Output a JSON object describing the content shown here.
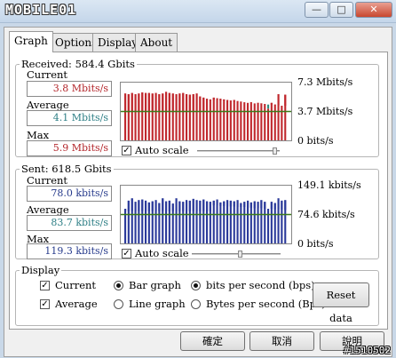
{
  "window": {
    "logo_text": "MOBILE01",
    "min_label": "—",
    "max_label": "□",
    "close_label": "✕"
  },
  "tabs": [
    {
      "label": "Graph"
    },
    {
      "label": "Options"
    },
    {
      "label": "Display"
    },
    {
      "label": "About"
    }
  ],
  "received": {
    "legend": "Received: 584.4 Gbits",
    "current_label": "Current",
    "current_value": "3.8 Mbits/s",
    "average_label": "Average",
    "average_value": "4.1 Mbits/s",
    "max_label": "Max",
    "max_value": "5.9 Mbits/s",
    "axis_top": "7.3 Mbits/s",
    "axis_mid": "3.7 Mbits/s",
    "axis_bottom": "0  bits/s",
    "autoscale_label": "Auto scale",
    "autoscale_checked": true,
    "slider_level": 0.97,
    "bar_color": "#c0282d",
    "avg_color": "#2f8c7e",
    "grid_color": "#3c7a1a",
    "avg_level": 0.5
  },
  "sent": {
    "legend": "Sent: 618.5 Gbits",
    "current_label": "Current",
    "current_value": "78.0 kbits/s",
    "average_label": "Average",
    "average_value": "83.7 kbits/s",
    "max_label": "Max",
    "max_value": "119.3 kbits/s",
    "axis_top": "149.1 kbits/s",
    "axis_mid": "74.6 kbits/s",
    "axis_bottom": "0  bits/s",
    "autoscale_label": "Auto scale",
    "autoscale_checked": true,
    "slider_level": 0.55,
    "bar_color": "#2b3a9a",
    "avg_color": "#2f8c7e",
    "grid_color": "#3c7a1a",
    "avg_level": 0.5
  },
  "display": {
    "legend": "Display",
    "current_label": "Current",
    "current_checked": true,
    "average_label": "Average",
    "average_checked": true,
    "bar_graph_label": "Bar graph",
    "bar_graph_selected": true,
    "line_graph_label": "Line graph",
    "line_graph_selected": false,
    "bps_label": "bits per second (bps)",
    "bps_selected": true,
    "Bps_label": "Bytes per second (Bps)",
    "Bps_selected": false,
    "reset_label": "Reset data"
  },
  "buttons": {
    "ok": "確定",
    "cancel": "取消",
    "help": "說明"
  },
  "watermark": "#1510502",
  "chart_data": [
    {
      "type": "bar",
      "series": [
        {
          "name": "Current",
          "color": "#c0282d",
          "values": [
            0.81,
            0.8,
            0.82,
            0.8,
            0.81,
            0.83,
            0.82,
            0.82,
            0.81,
            0.82,
            0.8,
            0.81,
            0.84,
            0.82,
            0.81,
            0.8,
            0.81,
            0.82,
            0.8,
            0.79,
            0.8,
            0.81,
            0.76,
            0.74,
            0.72,
            0.71,
            0.74,
            0.73,
            0.72,
            0.71,
            0.7,
            0.69,
            0.7,
            0.68,
            0.67,
            0.66,
            0.65,
            0.66,
            0.64,
            0.65,
            0.64,
            0.63,
            0.55,
            0.65,
            0.62,
            0.8,
            0.6,
            0.79
          ]
        },
        {
          "name": "Average",
          "color": "#2f8c7e",
          "values": [
            0.48,
            0.48,
            0.49,
            0.49,
            0.49,
            0.5,
            0.5,
            0.5,
            0.5,
            0.5,
            0.5,
            0.5,
            0.5,
            0.5,
            0.5,
            0.5,
            0.5,
            0.5,
            0.5,
            0.5,
            0.5,
            0.5,
            0.5,
            0.5,
            0.71,
            0.7,
            0.7,
            0.7,
            0.69,
            0.69,
            0.68,
            0.68,
            0.67,
            0.67,
            0.66,
            0.66,
            0.65,
            0.65,
            0.64,
            0.64,
            0.63,
            0.63,
            0.62,
            0.62,
            0.61,
            0.61,
            0.6,
            0.6
          ]
        }
      ]
    },
    {
      "type": "bar",
      "series": [
        {
          "name": "Current",
          "color": "#2b3a9a",
          "values": [
            0.6,
            0.74,
            0.78,
            0.72,
            0.75,
            0.76,
            0.74,
            0.71,
            0.73,
            0.75,
            0.7,
            0.78,
            0.73,
            0.74,
            0.69,
            0.78,
            0.73,
            0.72,
            0.75,
            0.74,
            0.77,
            0.75,
            0.74,
            0.76,
            0.73,
            0.72,
            0.74,
            0.76,
            0.71,
            0.73,
            0.75,
            0.74,
            0.73,
            0.75,
            0.7,
            0.72,
            0.74,
            0.71,
            0.73,
            0.72,
            0.75,
            0.72,
            0.6,
            0.72,
            0.7,
            0.78,
            0.74,
            0.75
          ]
        },
        {
          "name": "Average",
          "color": "#2f8c7e",
          "values": [
            0.55,
            0.56,
            0.56,
            0.56,
            0.56,
            0.56,
            0.56,
            0.56,
            0.56,
            0.56,
            0.56,
            0.56,
            0.56,
            0.56,
            0.56,
            0.56,
            0.56,
            0.56,
            0.56,
            0.56,
            0.56,
            0.56,
            0.56,
            0.56,
            0.56,
            0.56,
            0.66,
            0.66,
            0.65,
            0.65,
            0.64,
            0.64,
            0.64,
            0.63,
            0.63,
            0.63,
            0.62,
            0.62,
            0.61,
            0.61,
            0.61,
            0.6,
            0.6,
            0.6,
            0.59,
            0.59,
            0.59,
            0.58
          ]
        }
      ]
    }
  ]
}
